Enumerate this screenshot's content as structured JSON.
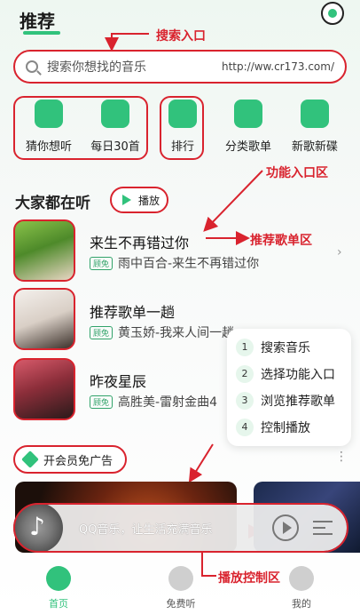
{
  "header": {
    "title": "推荐"
  },
  "search": {
    "placeholder": "搜索你想找的音乐",
    "url": "http://ww.cr173.com/"
  },
  "functions": [
    {
      "label": "猜你想听",
      "icon": "radio-icon"
    },
    {
      "label": "每日30首",
      "icon": "calendar-icon"
    },
    {
      "label": "排行",
      "icon": "chart-icon"
    },
    {
      "label": "分类歌单",
      "icon": "grid-icon"
    },
    {
      "label": "新歌新碟",
      "icon": "music-note-icon"
    }
  ],
  "section": {
    "title": "大家都在听",
    "play_label": "播放"
  },
  "playlists": [
    {
      "title": "来生不再错过你",
      "badge": "顾免",
      "subtitle": "雨中百合-来生不再错过你"
    },
    {
      "title": "推荐歌单一趟",
      "badge": "顾免",
      "subtitle": "黄玉娇-我来人间一趟"
    },
    {
      "title": "昨夜星辰",
      "badge": "顾免",
      "subtitle": "高胜美-雷射金曲4"
    }
  ],
  "steps": [
    {
      "num": "1",
      "label": "搜索音乐"
    },
    {
      "num": "2",
      "label": "选择功能入口"
    },
    {
      "num": "3",
      "label": "浏览推荐歌单"
    },
    {
      "num": "4",
      "label": "控制播放"
    }
  ],
  "vip": {
    "label": "开会员免广告"
  },
  "player": {
    "text": "QQ音乐，让生活充满音乐"
  },
  "nav": [
    {
      "label": "首页"
    },
    {
      "label": "免费听"
    },
    {
      "label": "我的"
    }
  ],
  "annotations": {
    "search": "搜索入口",
    "functions": "功能入口区",
    "playlists": "推荐歌单区",
    "player": "播放控制区"
  },
  "colors": {
    "accent": "#31c27c",
    "annotation": "#d9232e"
  }
}
